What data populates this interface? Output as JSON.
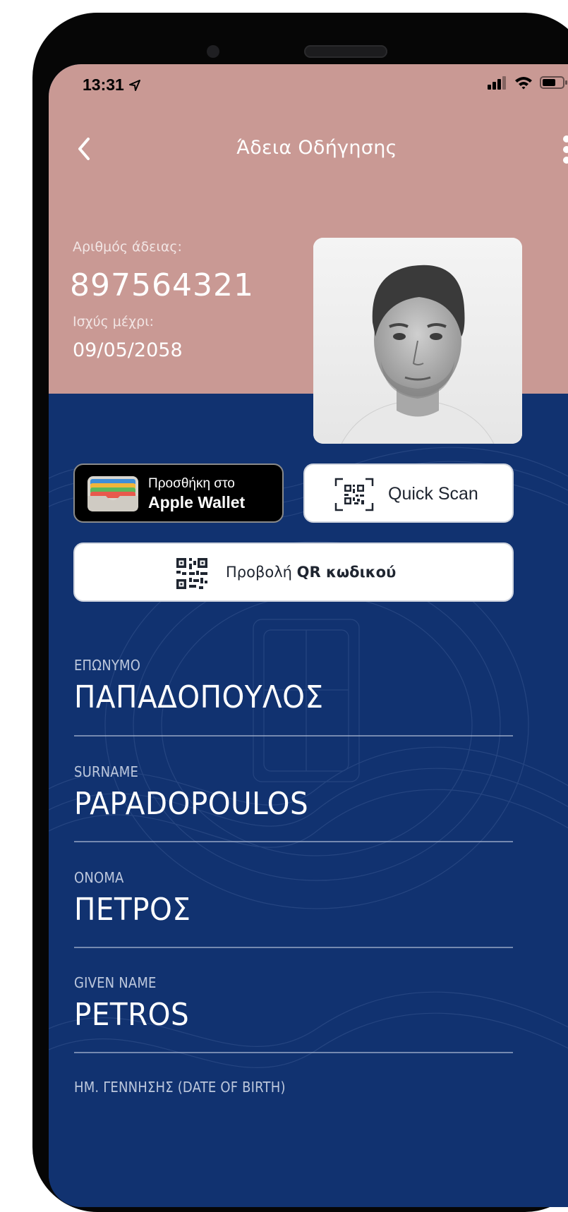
{
  "status_bar": {
    "time": "13:31"
  },
  "nav": {
    "title": "Άδεια Οδήγησης"
  },
  "license": {
    "number_label": "Αριθμός άδειας:",
    "number": "897564321",
    "valid_label": "Ισχύς μέχρι:",
    "valid_until": "09/05/2058"
  },
  "buttons": {
    "wallet_line1": "Προσθήκη στο",
    "wallet_line2": "Apple Wallet",
    "quick_scan": "Quick Scan",
    "qr_prefix": "Προβολή ",
    "qr_bold": "QR κωδικού"
  },
  "fields": [
    {
      "label": "ΕΠΩΝΥΜΟ",
      "value": "ΠΑΠΑΔΟΠΟΥΛΟΣ"
    },
    {
      "label": "SURNAME",
      "value": "PAPADOPOULOS"
    },
    {
      "label": "ΟΝΟΜΑ",
      "value": "ΠΕΤΡΟΣ"
    },
    {
      "label": "GIVEN NAME",
      "value": "PETROS"
    },
    {
      "label": "ΗΜ. ΓΕΝΝΗΣΗΣ (DATE OF BIRTH)",
      "value": ""
    }
  ],
  "colors": {
    "header": "#c99994",
    "body": "#113270",
    "white": "#ffffff"
  }
}
